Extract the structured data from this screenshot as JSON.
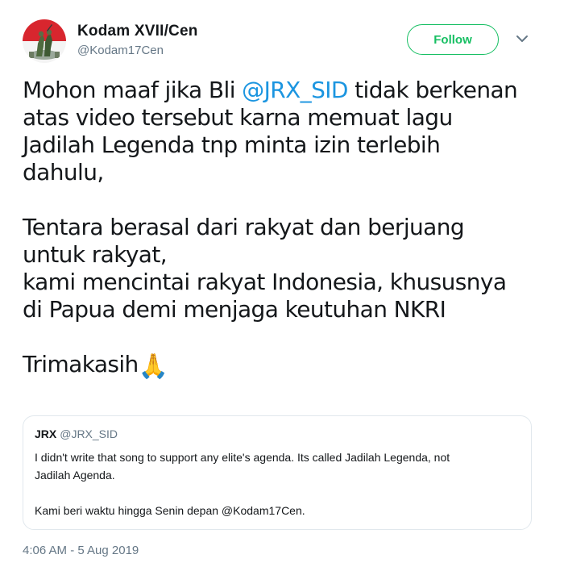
{
  "author": {
    "name": "Kodam XVII/Cen",
    "handle": "@Kodam17Cen",
    "avatar_icon": "military-emblem-avatar"
  },
  "follow_button": {
    "label": "Follow",
    "color": "#17bf63"
  },
  "menu_icon": "chevron-down-icon",
  "tweet": {
    "line1_pre": "Mohon maaf jika Bli ",
    "line1_mention": "@JRX_SID",
    "line1_post": " tidak berkenan",
    "line2": "atas video tersebut karna memuat lagu",
    "line3": "Jadilah Legenda tnp minta izin terlebih",
    "line4": "dahulu,",
    "line5": "Tentara berasal dari rakyat dan berjuang",
    "line6": "untuk rakyat,",
    "line7": "kami mencintai rakyat Indonesia, khususnya",
    "line8": "di Papua demi menjaga keutuhan NKRI",
    "line9": "Trimakasih",
    "emoji": "🙏",
    "mention_color": "#1b95e0"
  },
  "quote": {
    "name": "JRX",
    "handle": "@JRX_SID",
    "line1": "I didn't write that song to support any elite's agenda. Its called Jadilah Legenda, not",
    "line2": "Jadilah Agenda.",
    "line3": "Kami beri waktu hingga Senin depan @Kodam17Cen."
  },
  "timestamp": "4:06 AM - 5 Aug 2019"
}
